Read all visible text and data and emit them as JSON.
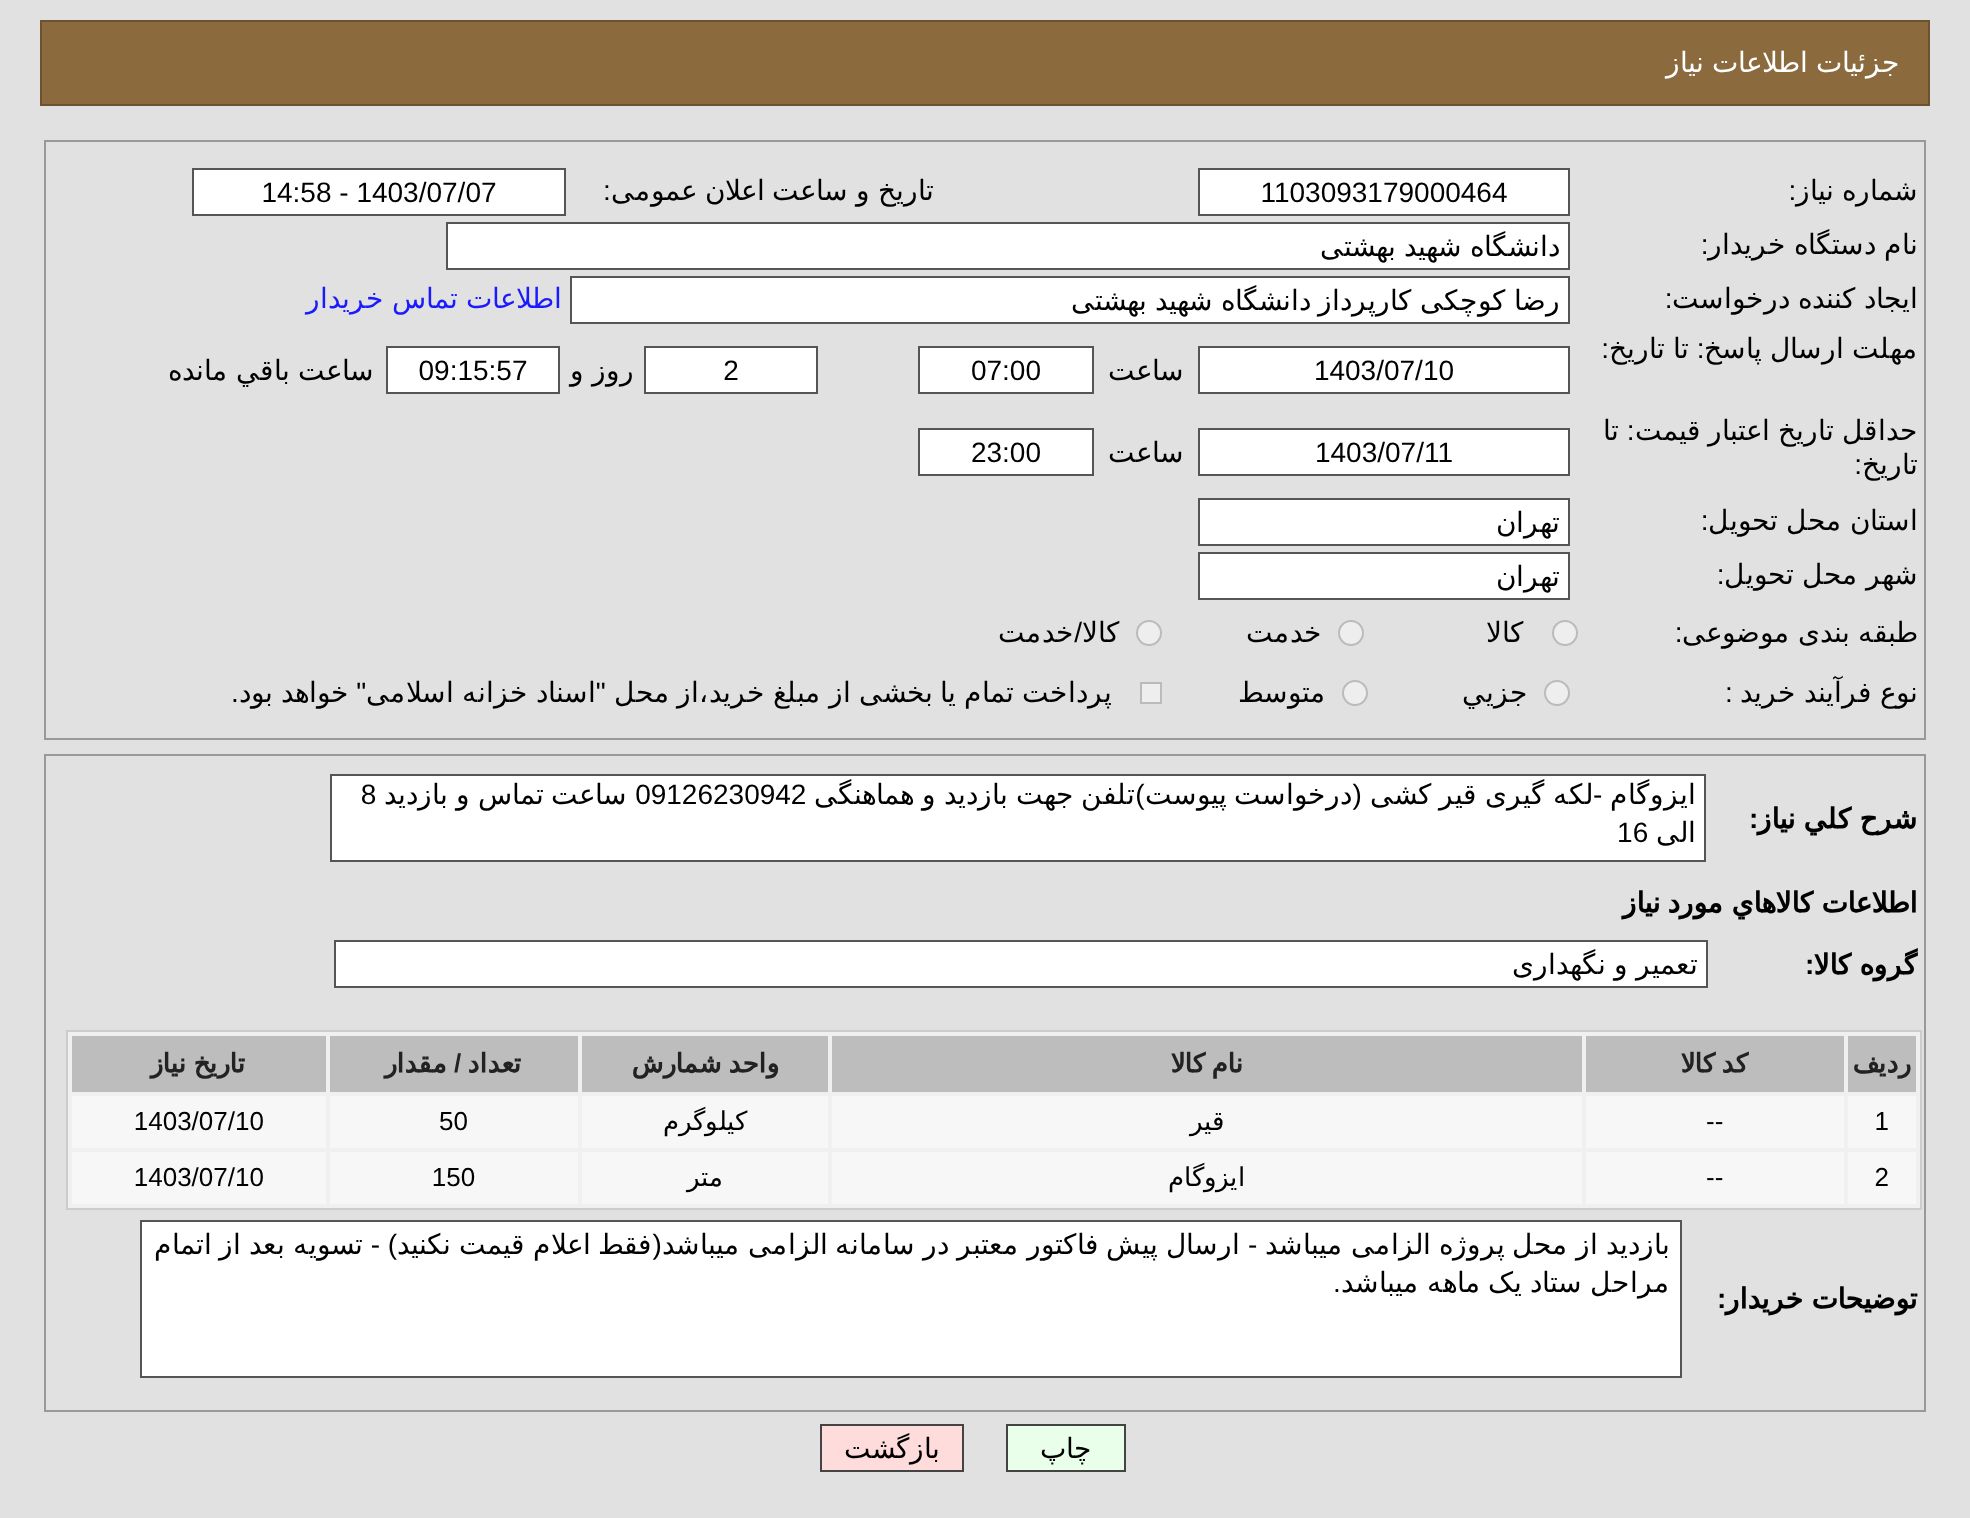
{
  "header": {
    "title": "جزئیات اطلاعات نیاز"
  },
  "details": {
    "need_number": {
      "label": "شماره نیاز:",
      "value": "1103093179000464"
    },
    "announce": {
      "label": "تاریخ و ساعت اعلان عمومی:",
      "value": "1403/07/07 - 14:58"
    },
    "buyer": {
      "label": "نام دستگاه خریدار:",
      "value": "دانشگاه شهید بهشتی"
    },
    "creator": {
      "label": "ایجاد کننده درخواست:",
      "value": "رضا کوچکی کارپرداز دانشگاه شهید بهشتی",
      "link": "اطلاعات تماس خریدار"
    },
    "reply_deadline": {
      "label": "مهلت ارسال پاسخ: تا تاریخ:",
      "date": "1403/07/10",
      "time_label": "ساعت",
      "time": "07:00",
      "days": "2",
      "days_label": "روز و",
      "remaining": "09:15:57",
      "remaining_label": "ساعت باقي مانده"
    },
    "price_validity": {
      "label": "حداقل تاریخ اعتبار قیمت: تا تاریخ:",
      "date": "1403/07/11",
      "time_label": "ساعت",
      "time": "23:00"
    },
    "province": {
      "label": "استان محل تحویل:",
      "value": "تهران"
    },
    "city": {
      "label": "شهر محل تحویل:",
      "value": "تهران"
    },
    "category": {
      "label": "طبقه بندی موضوعی:",
      "options": [
        {
          "label": "کالا",
          "selected": false
        },
        {
          "label": "خدمت",
          "selected": false
        },
        {
          "label": "کالا/خدمت",
          "selected": false
        }
      ]
    },
    "process": {
      "label": "نوع فرآیند خرید :",
      "options": [
        {
          "label": "جزيي",
          "selected": false
        },
        {
          "label": "متوسط",
          "selected": false
        }
      ],
      "treasury": {
        "label": "پرداخت تمام یا بخشی از مبلغ خرید،از محل \"اسناد خزانه اسلامی\" خواهد بود.",
        "checked": false
      }
    }
  },
  "need": {
    "description_label": "شرح کلي نیاز:",
    "description": "ایزوگام -لکه گیری قیر کشی (درخواست پیوست)تلفن جهت بازدید و هماهنگی 09126230942 ساعت تماس و بازدید 8 الی 16",
    "goods_title": "اطلاعات کالاهاي مورد نیاز",
    "group_label": "گروه کالا:",
    "group": "تعمیر و نگهداری",
    "table": {
      "columns": [
        "ردیف",
        "کد کالا",
        "نام کالا",
        "واحد شمارش",
        "تعداد / مقدار",
        "تاریخ نیاز"
      ],
      "rows": [
        [
          "1",
          "--",
          "قیر",
          "کیلوگرم",
          "50",
          "1403/07/10"
        ],
        [
          "2",
          "--",
          "ایزوگام",
          "متر",
          "150",
          "1403/07/10"
        ]
      ]
    },
    "notes_label": "توضیحات خریدار:",
    "notes": "بازدید از محل پروژه الزامی میباشد - ارسال پیش فاکتور معتبر در سامانه الزامی میباشد(فقط اعلام قیمت نکنید) - تسویه بعد از اتمام مراحل ستاد یک ماهه میباشد."
  },
  "buttons": [
    {
      "label": "چاپ",
      "kind": "print"
    },
    {
      "label": "بازگشت",
      "kind": "back"
    }
  ]
}
